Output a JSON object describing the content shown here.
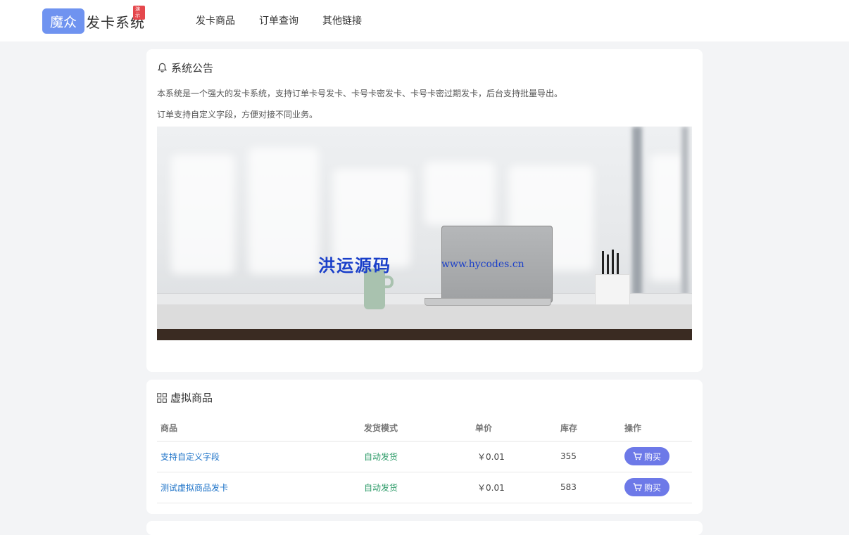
{
  "header": {
    "logo_mark": "魔众",
    "logo_text": "发卡系统",
    "logo_badge": "演示",
    "nav": [
      {
        "label": "发卡商品"
      },
      {
        "label": "订单查询"
      },
      {
        "label": "其他链接"
      }
    ]
  },
  "notice": {
    "title": "系统公告",
    "line1": "本系统是一个强大的发卡系统，支持订单卡号发卡、卡号卡密发卡、卡号卡密过期发卡，后台支持批量导出。",
    "line2": "订单支持自定义字段，方便对接不同业务。",
    "banner_watermark_cn": "洪运源码",
    "banner_watermark_url": "www.hycodes.cn"
  },
  "goods": {
    "title": "虚拟商品",
    "columns": [
      "商品",
      "发货模式",
      "单价",
      "库存",
      "操作"
    ],
    "rows": [
      {
        "name": "支持自定义字段",
        "mode": "自动发货",
        "price": "￥0.01",
        "stock": "355",
        "action": "购买"
      },
      {
        "name": "测试虚拟商品发卡",
        "mode": "自动发货",
        "price": "￥0.01",
        "stock": "583",
        "action": "购买"
      }
    ]
  },
  "colors": {
    "accent": "#6d79e8",
    "logo": "#6f93f0",
    "link": "#1e73c8",
    "mode": "#2f9c6a",
    "background": "#f3f4f6"
  },
  "icons": {
    "notice": "bell-icon",
    "goods": "grid-icon",
    "buy": "cart-icon"
  }
}
